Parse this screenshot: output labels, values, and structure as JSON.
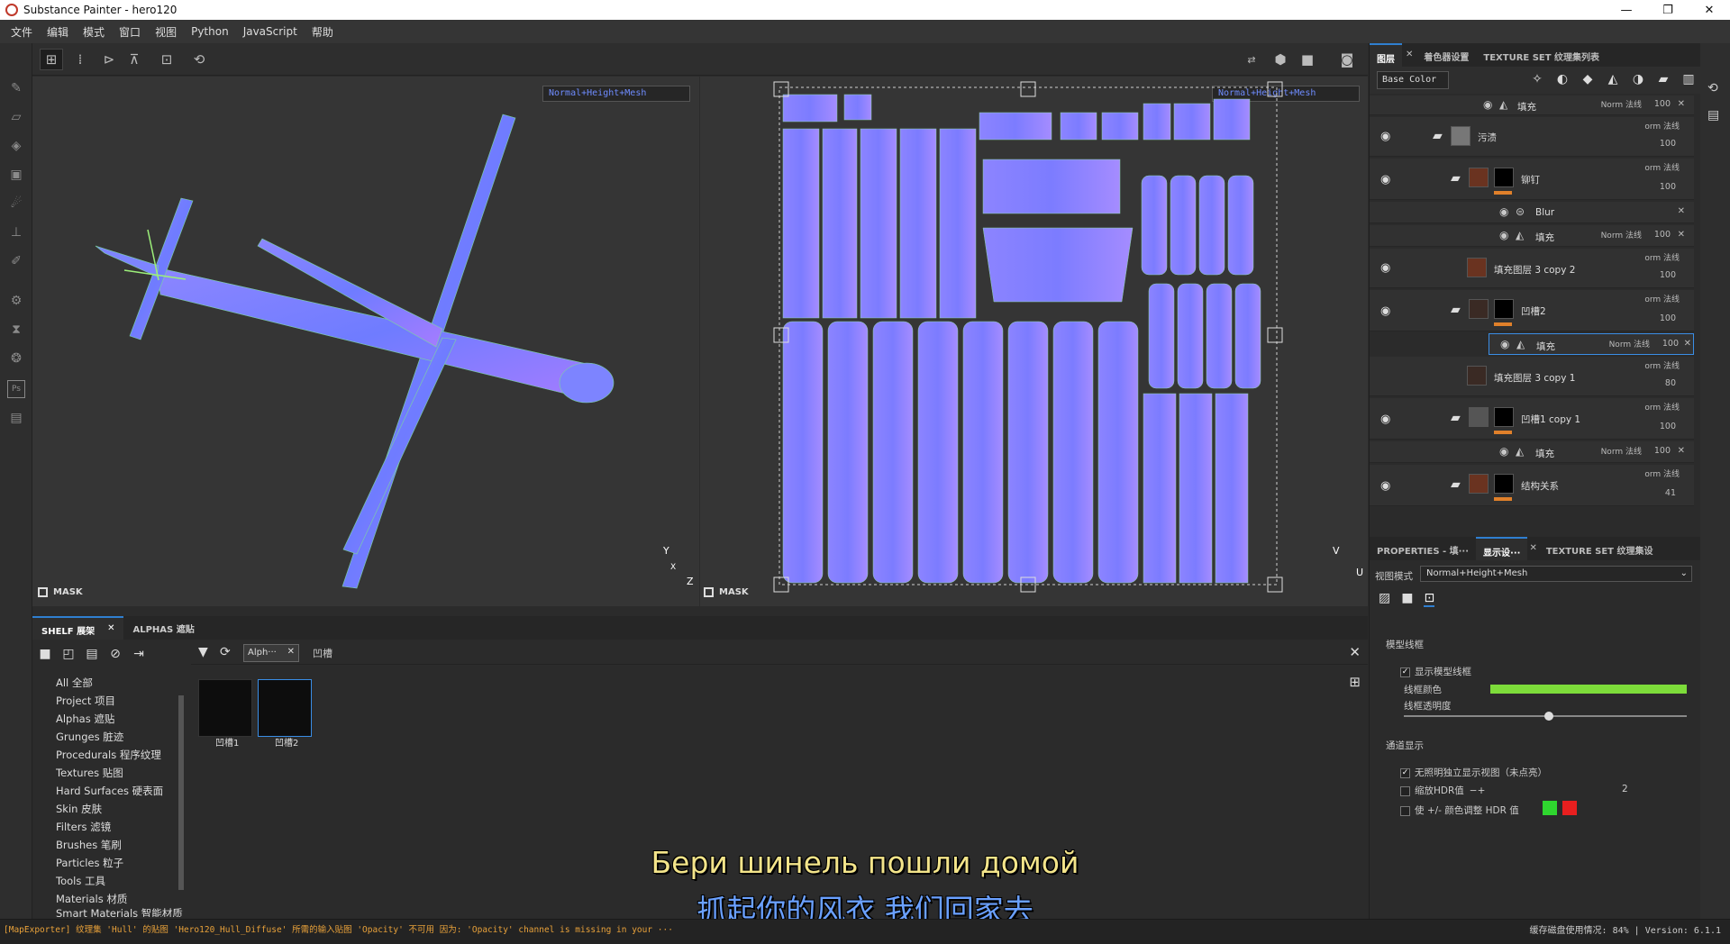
{
  "window": {
    "title": "Substance Painter - hero120",
    "controls": [
      "—",
      "❐",
      "✕"
    ]
  },
  "menu": [
    "文件",
    "编辑",
    "模式",
    "窗口",
    "视图",
    "Python",
    "JavaScript",
    "帮助"
  ],
  "viewport": {
    "left_mode": "Normal+Height+Mesh",
    "right_mode": "Normal+Height+Mesh",
    "mask_label": "MASK",
    "axis_y": "Y",
    "axis_z": "Z",
    "axis_x": "X",
    "axis_u": "U",
    "axis_v": "V"
  },
  "shelf": {
    "tabs": [
      {
        "label": "SHELF 展架"
      },
      {
        "label": "ALPHAS 遮贴"
      }
    ],
    "categories": [
      "All 全部",
      "Project 项目",
      "Alphas 遮贴",
      "Grunges 脏迹",
      "Procedurals 程序纹理",
      "Textures 贴图",
      "Hard Surfaces 硬表面",
      "Skin 皮肤",
      "Filters 滤镜",
      "Brushes 笔刷",
      "Particles 粒子",
      "Tools 工具",
      "Materials 材质",
      "Smart Materials 智能材质"
    ],
    "filter_chip": "Alph···",
    "search_text": "凹槽",
    "thumbs": [
      {
        "label": "凹槽1"
      },
      {
        "label": "凹槽2"
      }
    ]
  },
  "layers_panel": {
    "tabs": [
      "图层",
      "着色器设置",
      "TEXTURE SET 纹理集列表"
    ],
    "channel": "Base Color",
    "rows": [
      {
        "name": "填充",
        "blend": "Norm 法线",
        "opacity": "100"
      },
      {
        "name": "污渍",
        "blend": "orm 法线",
        "opacity": "100"
      },
      {
        "name": "铆钉",
        "blend": "orm 法线",
        "opacity": "100"
      },
      {
        "name": "Blur",
        "blend": "",
        "opacity": ""
      },
      {
        "name": "填充",
        "blend": "Norm 法线",
        "opacity": "100"
      },
      {
        "name": "填充图层 3 copy 2",
        "blend": "orm 法线",
        "opacity": "100"
      },
      {
        "name": "凹槽2",
        "blend": "orm 法线",
        "opacity": "100"
      },
      {
        "name": "填充",
        "blend": "Norm 法线",
        "opacity": "100"
      },
      {
        "name": "填充图层 3 copy 1",
        "blend": "orm 法线",
        "opacity": "80"
      },
      {
        "name": "凹槽1 copy 1",
        "blend": "orm 法线",
        "opacity": "100"
      },
      {
        "name": "填充",
        "blend": "Norm 法线",
        "opacity": "100"
      },
      {
        "name": "结构关系",
        "blend": "orm 法线",
        "opacity": "41"
      }
    ]
  },
  "props_panel": {
    "tabs": [
      "PROPERTIES - 填···",
      "显示设···",
      "TEXTURE SET 纹理集设"
    ],
    "view_mode_label": "视图模式",
    "view_mode": "Normal+Height+Mesh",
    "section_wire": "模型线框",
    "show_wire": "显示模型线框",
    "wire_color": "线框颜色",
    "wire_opacity": "线框透明度",
    "section_channel": "通道显示",
    "unlit": "无照明独立显示视图（未点亮）",
    "hdr": "缩放HDR值",
    "hdr_value": "2",
    "hdr_color": "使 +/- 颜色调整 HDR 值",
    "wire_color_hex": "#7ddc3a"
  },
  "status": {
    "left": "[MapExporter] 纹理集 'Hull' 的贴图 'Hero120_Hull_Diffuse' 所需的输入贴图 'Opacity' 不可用 因为: 'Opacity' channel is missing in your ···",
    "right": "缓存磁盘使用情况:   84% | Version: 6.1.1"
  },
  "subtitles": {
    "ru": "Бери шинель пошли домой",
    "zh": "抓起你的风衣 我们回家去"
  }
}
